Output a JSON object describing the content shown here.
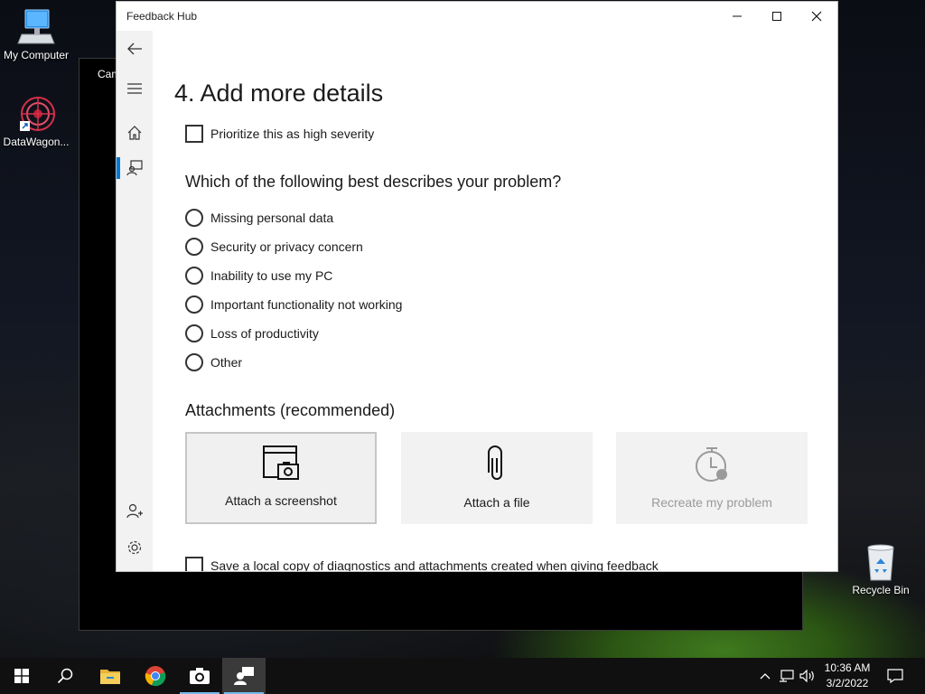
{
  "desktop": {
    "icons": [
      {
        "label": "My Computer"
      },
      {
        "label": "DataWagon..."
      },
      {
        "label": "Recycle Bin"
      }
    ]
  },
  "background_window": {
    "title": "Cam"
  },
  "window": {
    "title": "Feedback Hub",
    "controls": {
      "minimize": "—",
      "maximize": "☐",
      "close": "✕"
    }
  },
  "nav": {
    "items": [
      {
        "icon": "back-arrow-icon"
      },
      {
        "icon": "hamburger-menu-icon"
      },
      {
        "icon": "home-icon"
      },
      {
        "icon": "feedback-icon"
      },
      {
        "icon": "add-person-icon"
      },
      {
        "icon": "gear-icon"
      }
    ],
    "active_color": "#0078d7"
  },
  "content": {
    "page_title": "4. Add more details",
    "severity_checkbox": {
      "label": "Prioritize this as high severity",
      "checked": false
    },
    "problem_question": "Which of the following best describes your problem?",
    "problem_options": [
      {
        "label": "Missing personal data"
      },
      {
        "label": "Security or privacy concern"
      },
      {
        "label": "Inability to use my PC"
      },
      {
        "label": "Important functionality not working"
      },
      {
        "label": "Loss of productivity"
      },
      {
        "label": "Other"
      }
    ],
    "attachments_heading": "Attachments (recommended)",
    "attachments": [
      {
        "label": "Attach a screenshot",
        "icon": "screenshot-camera-icon"
      },
      {
        "label": "Attach a file",
        "icon": "paperclip-icon"
      },
      {
        "label": "Recreate my problem",
        "icon": "stopwatch-record-icon",
        "disabled": true
      }
    ],
    "save_copy_checkbox": {
      "label": "Save a local copy of diagnostics and attachments created when giving feedback",
      "checked": false
    }
  },
  "taskbar": {
    "buttons": [
      {
        "icon": "windows-start-icon"
      },
      {
        "icon": "search-icon"
      },
      {
        "icon": "file-explorer-icon"
      },
      {
        "icon": "chrome-icon"
      },
      {
        "icon": "camera-icon"
      },
      {
        "icon": "feedback-hub-icon",
        "active": true
      }
    ],
    "tray": [
      "chevron-up-icon",
      "network-icon",
      "volume-icon"
    ],
    "clock": {
      "time": "10:36 AM",
      "date": "3/2/2022"
    },
    "notification_icon": "action-center-icon"
  }
}
